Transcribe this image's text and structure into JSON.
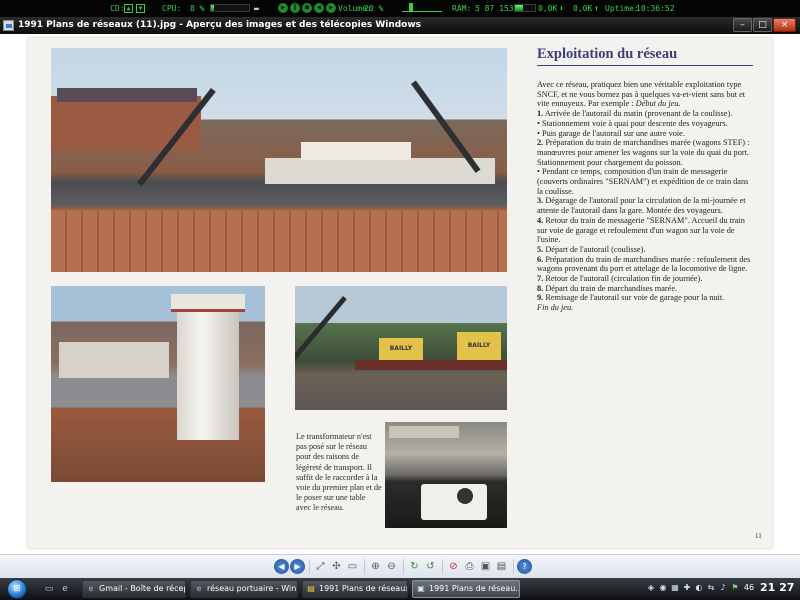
{
  "sysbar": {
    "cd_label": "CD:",
    "cpu_label": "CPU:",
    "cpu_value": "8 %",
    "cpu_level": 0.08,
    "volume_label": "Volume:",
    "volume_value": "20 %",
    "volume_level": 0.2,
    "ram_label": "RAM:",
    "ram_value": "5 87 1536",
    "ram_level": 0.38,
    "down_value": "0,0K",
    "up_value": "0,0K",
    "uptime_label": "Uptime:",
    "uptime_value": "10:36:52"
  },
  "window": {
    "title": "1991 Plans de réseaux (11).jpg - Aperçu des images et des télécopies Windows",
    "minimize": "–",
    "maximize": "□",
    "close": "×"
  },
  "article": {
    "heading": "Exploitation du réseau",
    "intro": "Avec ce réseau, pratiquez bien une véritable exploitation type SNCF, et ne vous bornez pas à quelques va-et-vient sans but et vite ennuyeux.",
    "example_label": "Par exemple :",
    "example_start": "Début du jeu.",
    "steps": [
      {
        "num": "1.",
        "text": "Arrivée de l'autorail du matin (provenant de la coulisse)."
      },
      {
        "num": "•",
        "text": "Stationnement voie à quai pour descente des voyageurs."
      },
      {
        "num": "•",
        "text": "Puis garage de l'autorail sur une autre voie."
      },
      {
        "num": "2.",
        "text": "Préparation du train de marchandises marée (wagons STEF) : manœuvres pour amener les wagons sur la voie du quai du port. Stationnement pour chargement du poisson."
      },
      {
        "num": "•",
        "text": "Pendant ce temps, composition d'un train de messagerie (couverts ordinaires \"SERNAM\") et expédition de ce train dans la coulisse."
      },
      {
        "num": "3.",
        "text": "Dégarage de l'autorail pour la circulation de la mi-journée et attente de l'autorail dans la gare. Montée des voyageurs."
      },
      {
        "num": "4.",
        "text": "Retour du train de messagerie \"SERNAM\". Accueil du train sur voie de garage et refoulement d'un wagon sur la voie de l'usine."
      },
      {
        "num": "5.",
        "text": "Départ de l'autorail (coulisse)."
      },
      {
        "num": "6.",
        "text": "Préparation du train de marchandises marée : refoulement des wagons provenant du port et attelage de la locomotive de ligne."
      },
      {
        "num": "7.",
        "text": "Retour de l'autorail (circulation fin de journée)."
      },
      {
        "num": "8.",
        "text": "Départ du train de marchandises marée."
      },
      {
        "num": "9.",
        "text": "Remisage de l'autorail sur voie de garage pour la nuit."
      }
    ],
    "end": "Fin du jeu.",
    "caption": "Le transformateur n'est pas posé sur le réseau pour des raisons de légèreté de transport. Il suffit de le raccorder à la voie du premier plan et de le poser sur une table avec le réseau.",
    "page_number": "11",
    "wagon_sign_1": "BAILLY",
    "wagon_sign_2": "BAILLY"
  },
  "toolbar": {
    "prev": "◀",
    "next": "▶",
    "best_fit": "⤢",
    "actual_size": "✣",
    "slideshow": "▭",
    "zoom_in": "⊕",
    "zoom_out": "⊖",
    "rotate_cw": "↻",
    "rotate_ccw": "↺",
    "delete": "⊘",
    "print": "⎙",
    "copy": "▣",
    "open": "▤",
    "help": "?"
  },
  "taskbar": {
    "start": "⊞",
    "quick_launch": [
      "▭",
      "e"
    ],
    "tasks": [
      {
        "label": "Gmail - Boîte de récept...",
        "icon": "e"
      },
      {
        "label": "réseau portuaire - Win...",
        "icon": "e"
      },
      {
        "label": "1991 Plans de réseaux",
        "icon": "▤"
      },
      {
        "label": "1991 Plans de réseau...",
        "icon": "▣"
      }
    ],
    "tray_icons": [
      "◈",
      "◉",
      "▦",
      "✚",
      "◐",
      "⇆",
      "♪",
      "⚑"
    ],
    "tray_number": "46",
    "clock": "21 27"
  }
}
